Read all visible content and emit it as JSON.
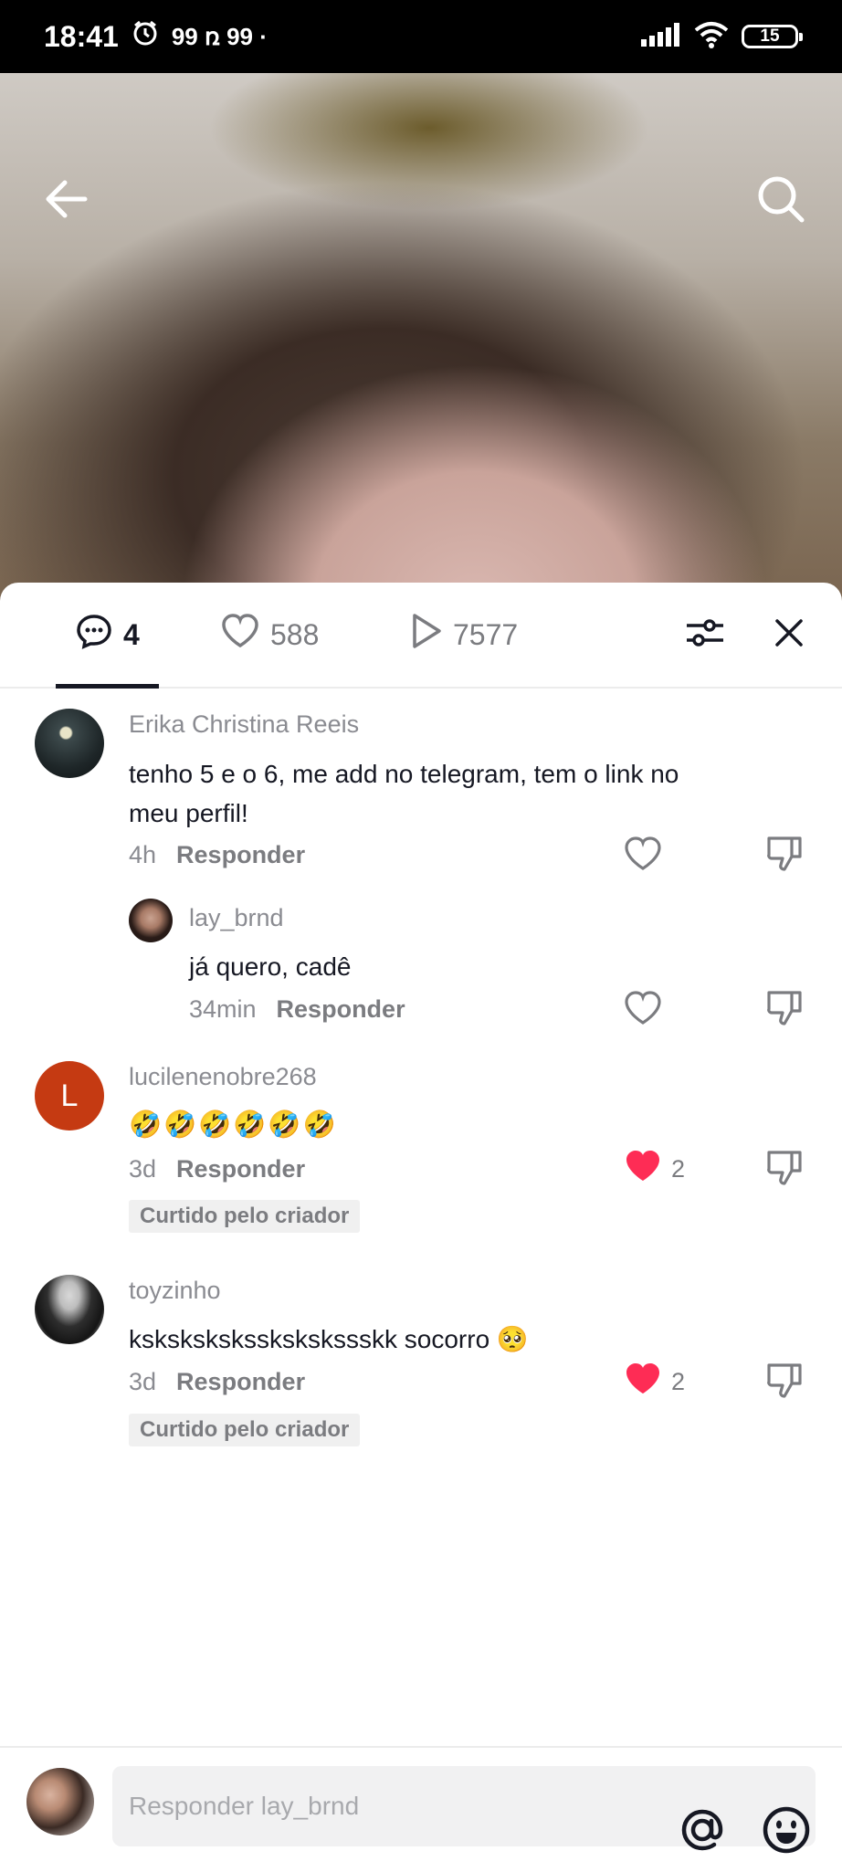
{
  "status_bar": {
    "time": "18:41",
    "extra": "99 ռ 99 ·",
    "battery": "15"
  },
  "tabs": {
    "comments_count": "4",
    "likes_count": "588",
    "views_count": "7577"
  },
  "comments": [
    {
      "username": "Erika Christina Reeis",
      "text_line1": "tenho 5 e o 6, me add no telegram, tem o link no",
      "text_line2": "meu perfil!",
      "time": "4h",
      "reply_label": "Responder"
    },
    {
      "username": "lay_brnd",
      "text": "já quero, cadê",
      "time": "34min",
      "reply_label": "Responder"
    },
    {
      "username": "lucilenenobre268",
      "avatar_letter": "L",
      "text": "🤣🤣🤣🤣🤣🤣",
      "time": "3d",
      "reply_label": "Responder",
      "likes": "2",
      "badge": "Curtido pelo criador"
    },
    {
      "username": "toyzinho",
      "text": "ksksksksksskskskssskk socorro 🥺",
      "time": "3d",
      "reply_label": "Responder",
      "likes": "2",
      "badge": "Curtido pelo criador"
    }
  ],
  "composer": {
    "placeholder": "Responder lay_brnd"
  },
  "colors": {
    "accent_heart": "#fe2c55",
    "text_primary": "#161823",
    "text_secondary": "#8a8b91"
  }
}
